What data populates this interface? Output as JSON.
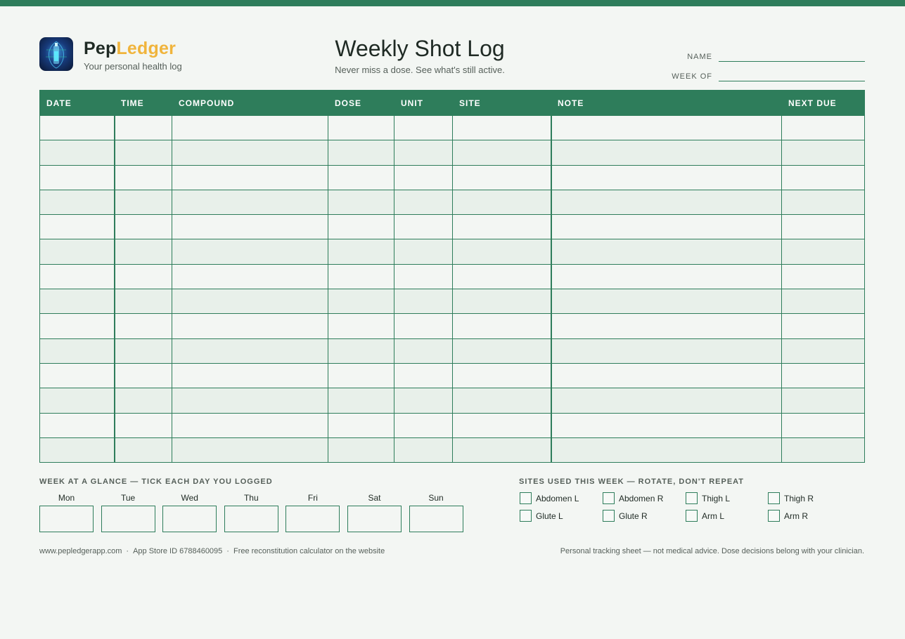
{
  "brand": {
    "name_part1": "Pep",
    "name_part2": "Ledger",
    "tagline": "Your personal health log",
    "accent_color": "#f0b43c",
    "primary_color": "#2e7d5b"
  },
  "header": {
    "title": "Weekly Shot Log",
    "subtitle": "Never miss a dose. See what's still active.",
    "name_label": "NAME",
    "week_of_label": "WEEK OF"
  },
  "table": {
    "columns": [
      "DATE",
      "TIME",
      "COMPOUND",
      "DOSE",
      "UNIT",
      "SITE",
      "NOTE",
      "NEXT DUE"
    ],
    "row_count": 14
  },
  "glance": {
    "label": "WEEK AT A GLANCE — TICK EACH DAY YOU LOGGED",
    "days": [
      "Mon",
      "Tue",
      "Wed",
      "Thu",
      "Fri",
      "Sat",
      "Sun"
    ]
  },
  "sites": {
    "label": "SITES USED THIS WEEK — ROTATE, DON'T REPEAT",
    "items": [
      "Abdomen L",
      "Abdomen R",
      "Thigh L",
      "Thigh R",
      "Glute L",
      "Glute R",
      "Arm L",
      "Arm R"
    ]
  },
  "footer": {
    "website": "www.pepledgerapp.com",
    "separator": "·",
    "app_store": "App Store ID 6788460095",
    "calculator": "Free reconstitution calculator on the website",
    "disclaimer": "Personal tracking sheet — not medical advice. Dose decisions belong with your clinician."
  }
}
